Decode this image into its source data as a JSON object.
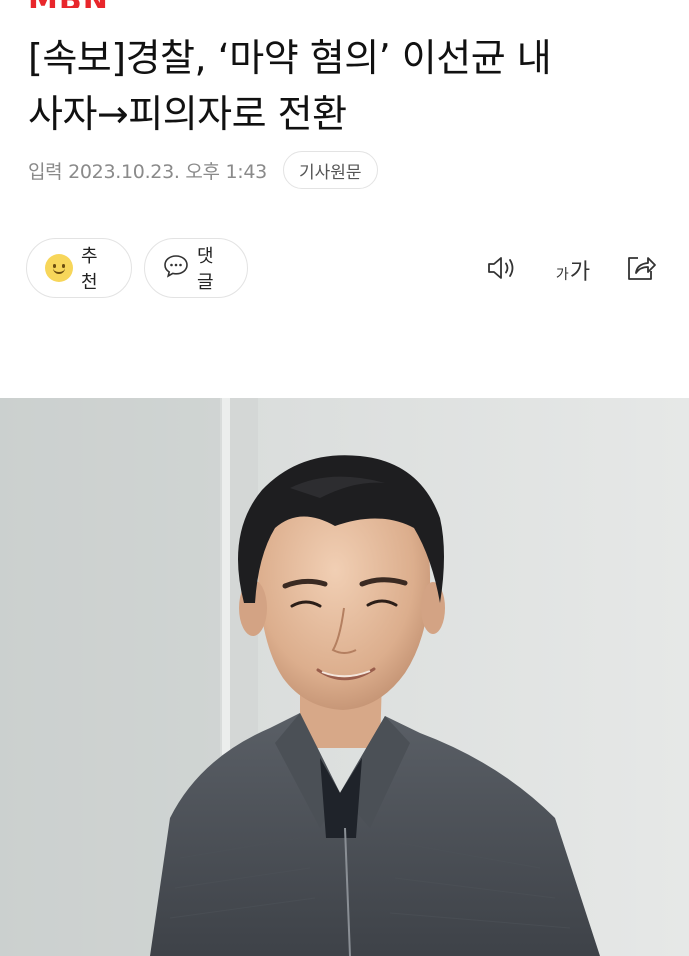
{
  "brand": {
    "logo_text": "MBN"
  },
  "article": {
    "headline_line1": "[속보]경찰, ‘마약 혐의’ 이선균 내",
    "headline_line2": "사자→피의자로 전환",
    "date": "입력 2023.10.23. 오후 1:43",
    "origin_button": "기사원문"
  },
  "actions": {
    "recommend_label": "추천",
    "comment_label": "댓글"
  },
  "tools": {
    "font_size_small": "가",
    "font_size_large": "가"
  },
  "icons": [
    "smiley-icon",
    "speech-bubble-icon",
    "speaker-icon",
    "font-size-icon",
    "share-icon"
  ],
  "colors": {
    "brand": "#e8262b",
    "meta_text": "#8a8a8a",
    "border": "#e3e3e3"
  }
}
